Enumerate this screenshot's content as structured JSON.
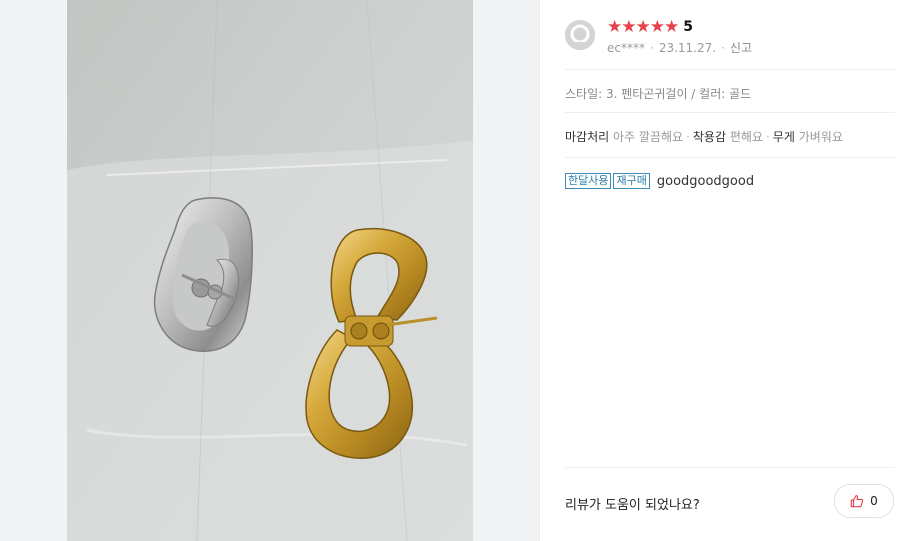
{
  "review": {
    "score": "5",
    "star_glyph": "★",
    "star_count": 5,
    "star_color": "#e8434d",
    "user": "ec****",
    "date": "23.11.27.",
    "report": "신고",
    "option": "스타일: 3. 펜타곤귀걸이 / 컬러: 골드",
    "attributes": [
      {
        "key": "마감처리",
        "value": "아주 깔끔해요"
      },
      {
        "key": "착용감",
        "value": "편해요"
      },
      {
        "key": "무게",
        "value": "가벼워요"
      }
    ],
    "tags": [
      "한달사용",
      "재구매"
    ],
    "text": "goodgoodgood"
  },
  "helpful": {
    "question": "리뷰가 도움이 되었나요?",
    "count": "0",
    "icon": "thumbs-up-icon",
    "icon_color": "#e8434d"
  },
  "photo": {
    "alt_subject": "silver-and-gold-pentagon-hoop-earrings"
  }
}
